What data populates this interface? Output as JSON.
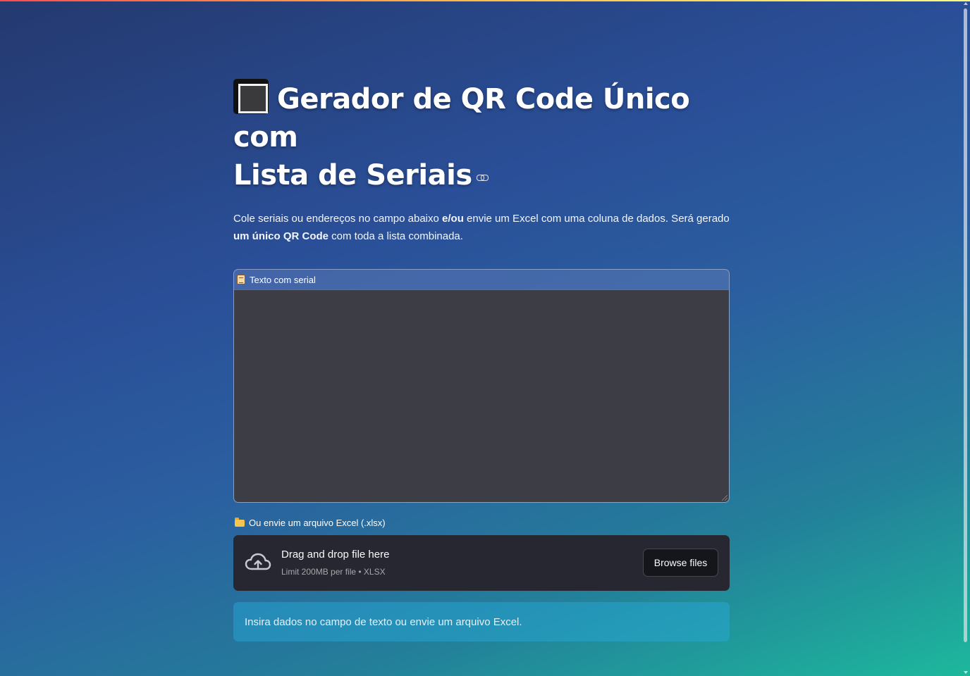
{
  "app": {
    "title_line1": "Gerador de QR Code Único com",
    "title_line2": "Lista de Seriais"
  },
  "description": {
    "part1": "Cole seriais ou endereços no campo abaixo ",
    "bold1": "e/ou",
    "part2": " envie um Excel com uma coluna de dados. Será gerado ",
    "bold2": "um único QR Code",
    "part3": " com toda a lista combinada."
  },
  "text_input": {
    "label": "Texto com serial",
    "value": ""
  },
  "uploader": {
    "label": "Ou envie um arquivo Excel (.xlsx)",
    "drag_text": "Drag and drop file here",
    "limit_text": "Limit 200MB per file • XLSX",
    "browse_label": "Browse files"
  },
  "info_message": "Insira dados no campo de texto ou envie um arquivo Excel.",
  "icons": {
    "title": "black-square-button-icon",
    "anchor": "link-icon",
    "text_label": "scroll-icon",
    "upload_label": "folder-icon",
    "dropzone": "cloud-upload-icon"
  }
}
